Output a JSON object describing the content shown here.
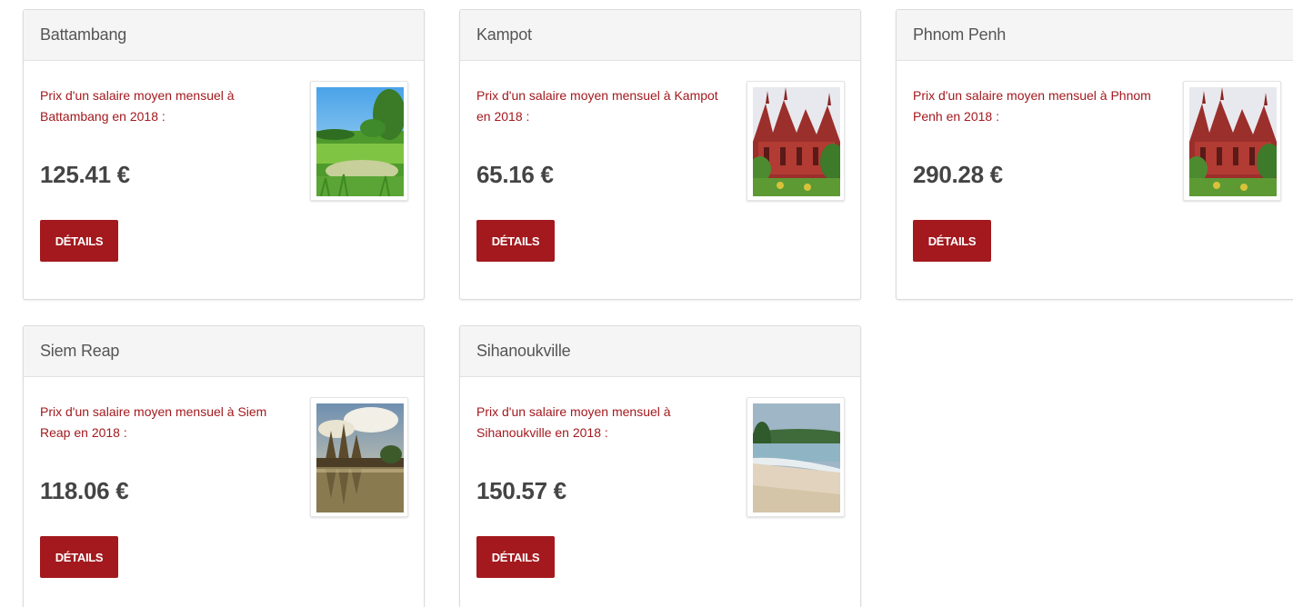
{
  "cards": [
    {
      "city": "Battambang",
      "description": "Prix d'un salaire moyen mensuel à Battambang en 2018 :",
      "price": "125.41 €",
      "button_label": "DÉTAILS",
      "image_icon": "rice-field-photo"
    },
    {
      "city": "Kampot",
      "description": "Prix d'un salaire moyen mensuel à Kampot en 2018 :",
      "price": "65.16 €",
      "button_label": "DÉTAILS",
      "image_icon": "temple-photo"
    },
    {
      "city": "Phnom Penh",
      "description": "Prix d'un salaire moyen mensuel à Phnom Penh en 2018 :",
      "price": "290.28 €",
      "button_label": "DÉTAILS",
      "image_icon": "temple-photo"
    },
    {
      "city": "Siem Reap",
      "description": "Prix d'un salaire moyen mensuel à Siem Reap en 2018 :",
      "price": "118.06 €",
      "button_label": "DÉTAILS",
      "image_icon": "angkor-wat-photo"
    },
    {
      "city": "Sihanoukville",
      "description": "Prix d'un salaire moyen mensuel à Sihanoukville en 2018 :",
      "price": "150.57 €",
      "button_label": "DÉTAILS",
      "image_icon": "beach-photo"
    }
  ],
  "colors": {
    "accent": "#a3191e",
    "price_text": "#444444",
    "header_bg": "#f5f5f5"
  }
}
